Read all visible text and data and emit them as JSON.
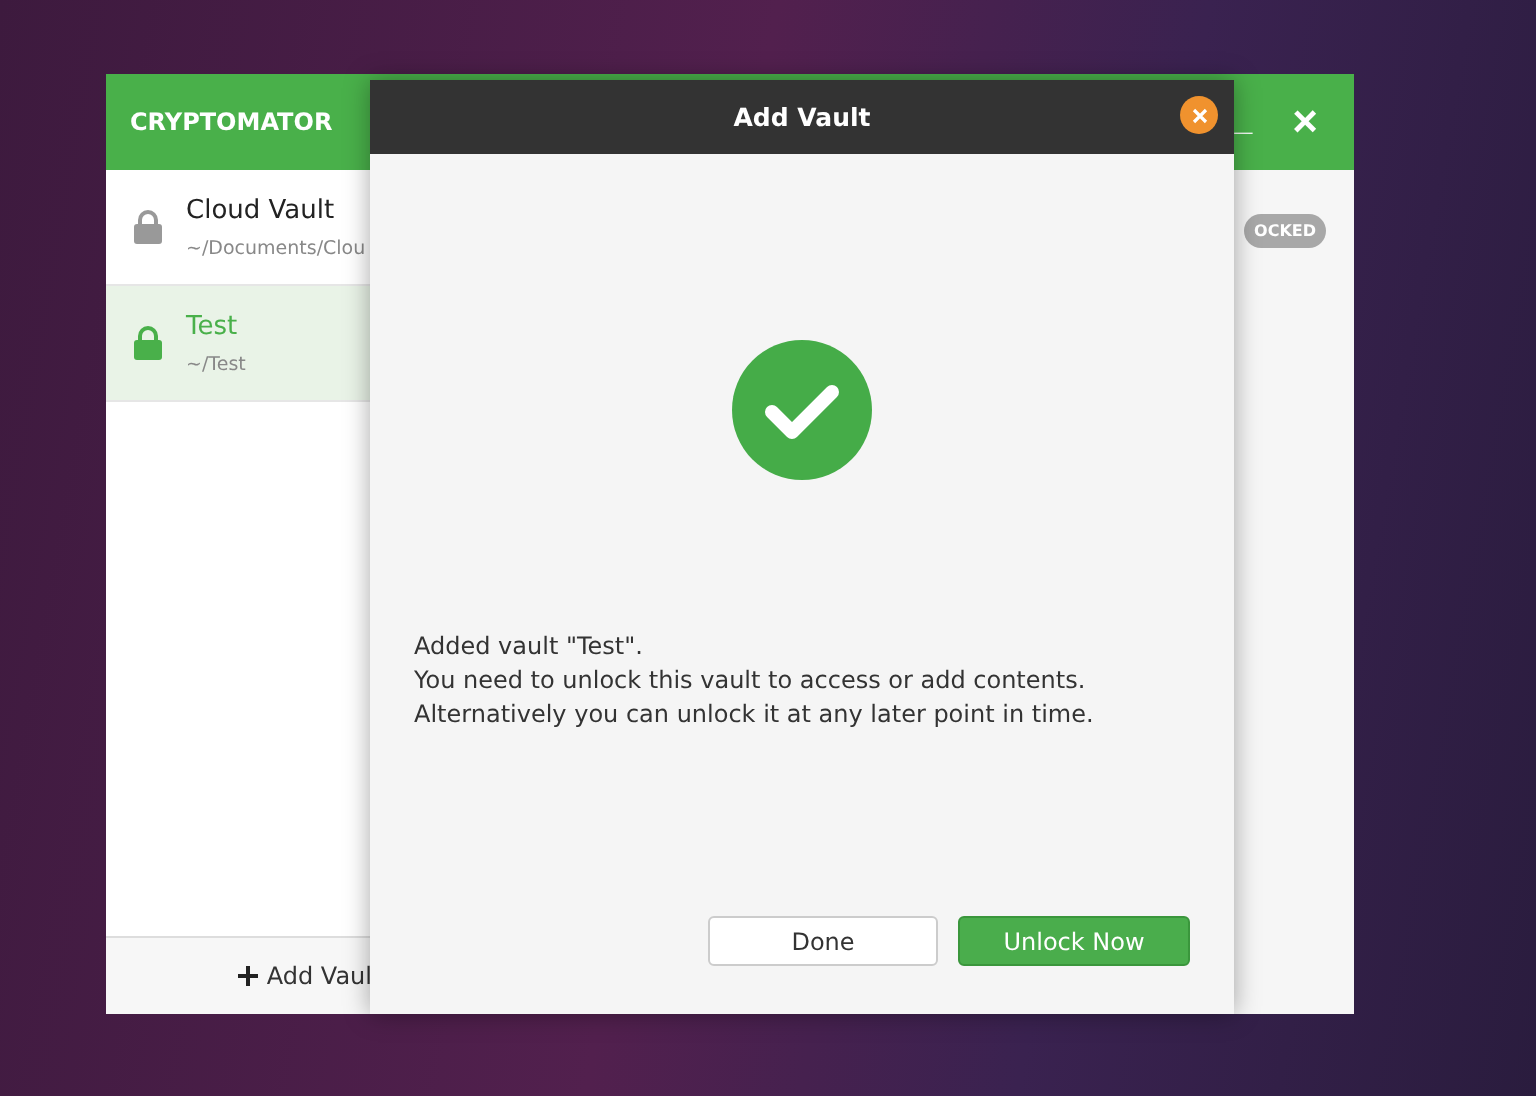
{
  "main_window": {
    "title": "CRYPTOMATOR",
    "minimize": "_",
    "close": "×",
    "vaults": [
      {
        "name": "Cloud Vault",
        "path": "~/Documents/Clou",
        "selected": false
      },
      {
        "name": "Test",
        "path": "~/Test",
        "selected": true
      }
    ],
    "add_vault": "Add Vaul",
    "status_badge": "OCKED"
  },
  "dialog": {
    "title": "Add Vault",
    "message": [
      "Added vault \"Test\".",
      "You need to unlock this vault to access or add contents.",
      "Alternatively you can unlock it at any later point in time."
    ],
    "buttons": [
      {
        "label": "Done",
        "kind": "secondary"
      },
      {
        "label": "Unlock Now",
        "kind": "primary"
      }
    ]
  }
}
